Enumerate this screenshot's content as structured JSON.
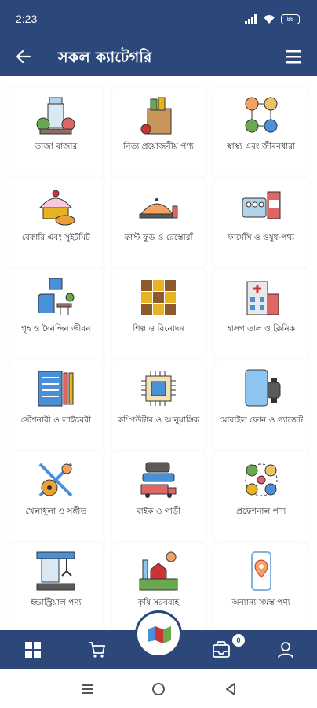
{
  "status_bar": {
    "time": "2:23",
    "battery": "88"
  },
  "app_bar": {
    "title": "সকল ক্যাটেগরি"
  },
  "categories": [
    {
      "label": "তাজা বাজার",
      "icon": "fresh-market-icon"
    },
    {
      "label": "নিত্য প্রয়োজনীয় পণ্য",
      "icon": "grocery-bag-icon"
    },
    {
      "label": "স্বাস্থ্য এবং জীবনধারা",
      "icon": "health-lifestyle-icon"
    },
    {
      "label": "বেকারি এবং সুইটমিট",
      "icon": "bakery-icon"
    },
    {
      "label": "ফাস্ট ফুড ও রেস্তোরাঁ",
      "icon": "fast-food-icon"
    },
    {
      "label": "ফার্মেসি ও ওষুধ-পথ্য",
      "icon": "pharmacy-icon"
    },
    {
      "label": "গৃহ ও দৈনন্দিন জীবন",
      "icon": "home-living-icon"
    },
    {
      "label": "শিল্প ও বিনোদন",
      "icon": "art-entertainment-icon"
    },
    {
      "label": "হাসপাতাল ও ক্লিনিক",
      "icon": "hospital-icon"
    },
    {
      "label": "স্টেশনারী ও লাইব্রেরী",
      "icon": "stationery-icon"
    },
    {
      "label": "কম্পিউটার ও আনুষাঙ্গিক",
      "icon": "computer-chip-icon"
    },
    {
      "label": "মোবাইল ফোন ও গ্যাজেট",
      "icon": "mobile-gadget-icon"
    },
    {
      "label": "খেলাধুলা ও সঙ্গীত",
      "icon": "sports-music-icon"
    },
    {
      "label": "বাইক ও গাড়ী",
      "icon": "vehicles-icon"
    },
    {
      "label": "প্রফেশনাল পণ্য",
      "icon": "professional-icon"
    },
    {
      "label": "ইন্ডাস্ট্রিয়াল পণ্য",
      "icon": "industrial-icon"
    },
    {
      "label": "কৃষি সরবরাহ",
      "icon": "agriculture-icon"
    },
    {
      "label": "অন্যান্য সমস্ত পণ্য",
      "icon": "other-products-icon"
    }
  ],
  "bottom_nav": {
    "cart_badge": "0"
  },
  "colors": {
    "primary": "#2c4779",
    "text": "#333333"
  }
}
